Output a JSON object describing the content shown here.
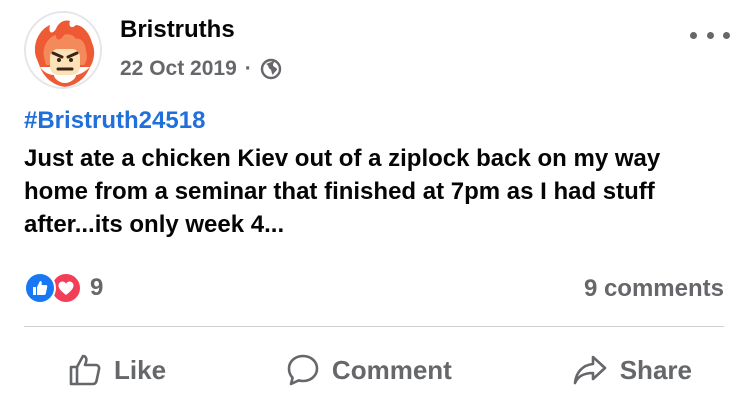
{
  "post": {
    "author": "Bristruths",
    "date": "22 Oct 2019",
    "separator": "·",
    "privacy_icon": "globe-icon",
    "hashtag": "#Bristruth24518",
    "text": "Just ate a chicken Kiev out of a ziplock back on my way home from a seminar that finished at 7pm as I had stuff after...its only week 4...",
    "reaction_count": "9",
    "comments_label": "9 comments",
    "reactions": [
      "like",
      "love"
    ]
  },
  "actions": {
    "like_label": "Like",
    "comment_label": "Comment",
    "share_label": "Share"
  },
  "colors": {
    "hashtag": "#216fdb",
    "like_reaction": "#1877f2",
    "love_reaction": "#f33e58",
    "secondary_text": "#65676b"
  }
}
